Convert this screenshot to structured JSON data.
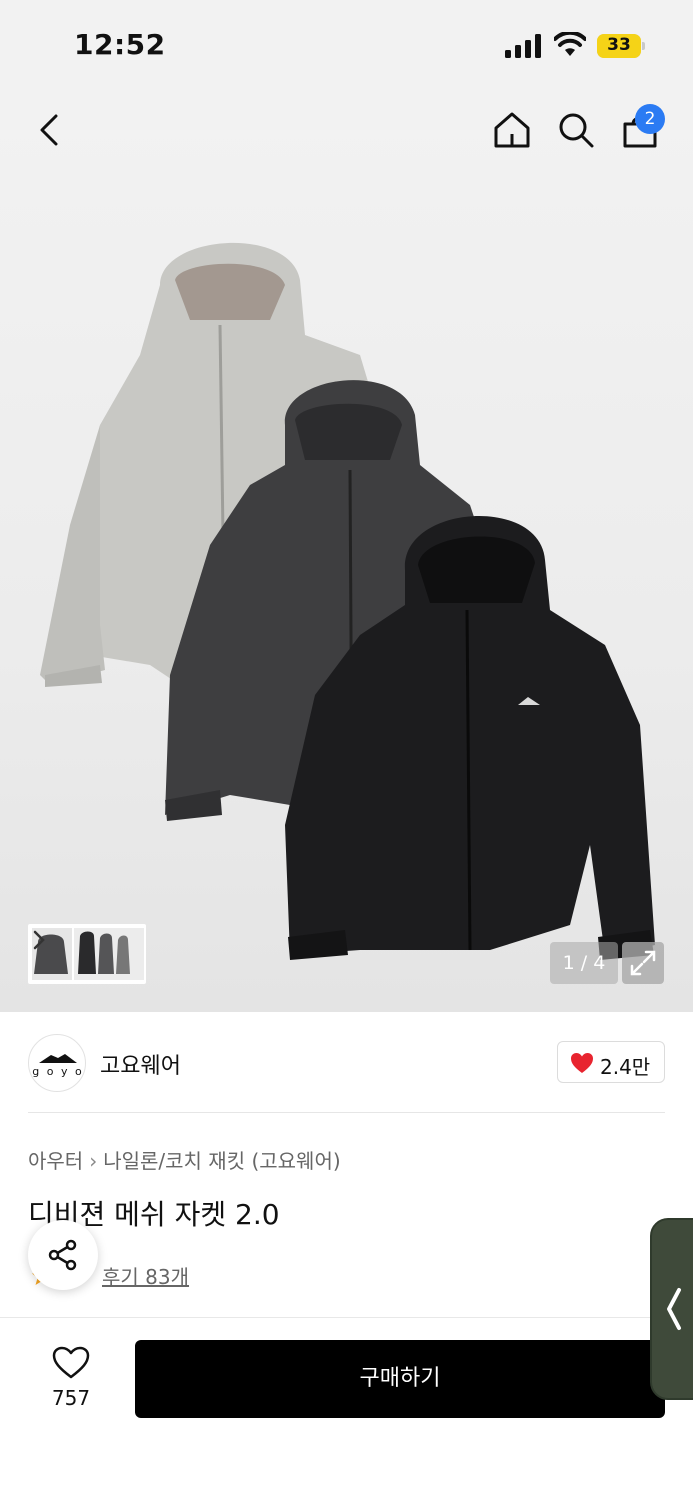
{
  "status_bar": {
    "time": "12:52",
    "battery_level": "33",
    "battery_fraction": 0.33,
    "icons": [
      "signal-icon",
      "wifi-icon",
      "battery-icon"
    ]
  },
  "nav": {
    "icons": [
      "back-icon",
      "home-icon",
      "search-icon",
      "shopping-bag-icon"
    ],
    "cart_count": "2"
  },
  "gallery": {
    "page_indicator": "1 / 4",
    "icons": [
      "expand-icon",
      "chevron-right-icon"
    ]
  },
  "brand": {
    "logo_text": "goyo",
    "name": "고요웨어",
    "like_count": "2.4만",
    "like_color": "#e8242f"
  },
  "product": {
    "breadcrumb": [
      "아우터",
      "나일론/코치 재킷 (고요웨어)"
    ],
    "title": "디비젼 메쉬 자켓 2.0",
    "review_link": "후기 83개",
    "star_color": "#f5a623"
  },
  "bottom_bar": {
    "wish_count": "757",
    "buy_label": "구매하기"
  },
  "colors": {
    "accent": "#2b7bf3",
    "buy_button": "#000000",
    "side_handle": "#3f4a3a"
  }
}
